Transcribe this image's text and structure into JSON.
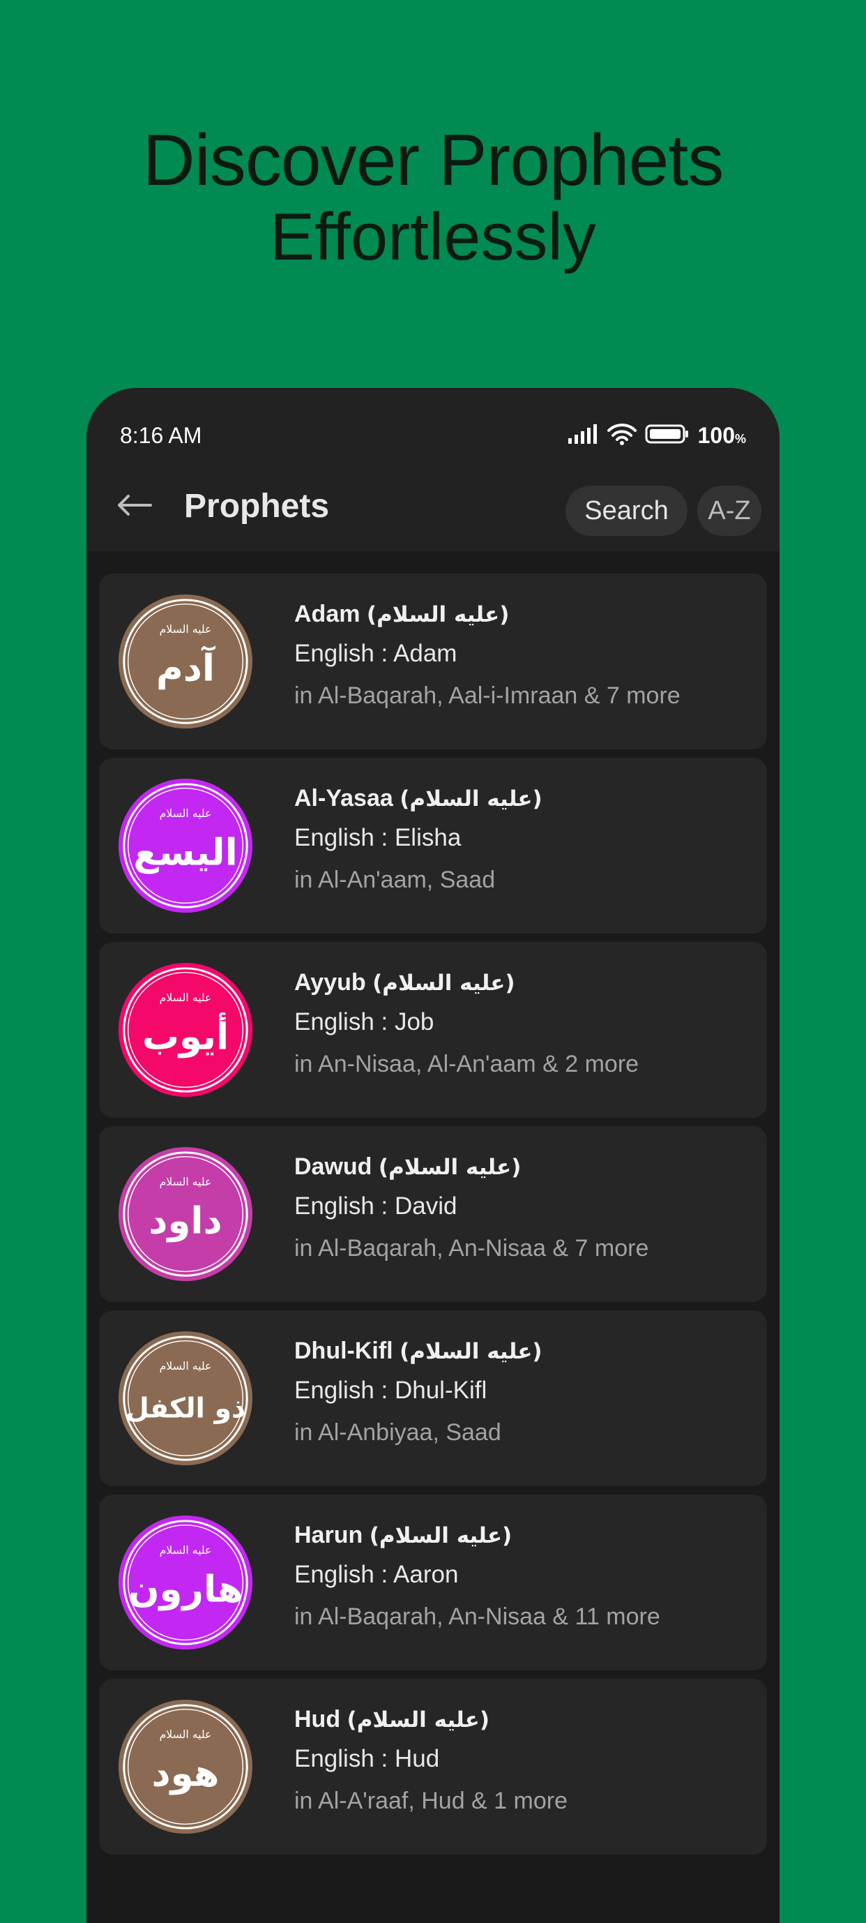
{
  "promo": {
    "headline_line1": "Discover Prophets",
    "headline_line2": "Effortlessly"
  },
  "status_bar": {
    "time": "8:16 AM",
    "battery": "100",
    "battery_unit": "%"
  },
  "toolbar": {
    "title": "Prophets",
    "search_label": "Search",
    "sort_label": "A-Z"
  },
  "prophets": [
    {
      "name": "Adam",
      "honorific": "(عليه السلام)",
      "english": "English : Adam",
      "surahs": "in Al-Baqarah, Aal-i-Imraan & 7 more",
      "color": "#8a6a52",
      "calligraphy": "آدم",
      "icon": "adam-calligraphy-icon"
    },
    {
      "name": "Al-Yasaa",
      "honorific": "(عليه السلام)",
      "english": "English : Elisha",
      "surahs": "in Al-An'aam, Saad",
      "color": "#c228f2",
      "calligraphy": "اليسع",
      "icon": "alyasaa-calligraphy-icon"
    },
    {
      "name": "Ayyub",
      "honorific": "(عليه السلام)",
      "english": "English : Job",
      "surahs": "in An-Nisaa, Al-An'aam & 2 more",
      "color": "#f4086a",
      "calligraphy": "أيوب",
      "icon": "ayyub-calligraphy-icon"
    },
    {
      "name": "Dawud",
      "honorific": "(عليه السلام)",
      "english": "English : David",
      "surahs": "in Al-Baqarah, An-Nisaa & 7 more",
      "color": "#c53da8",
      "calligraphy": "داود",
      "icon": "dawud-calligraphy-icon"
    },
    {
      "name": "Dhul-Kifl",
      "honorific": "(عليه السلام)",
      "english": "English : Dhul-Kifl",
      "surahs": "in Al-Anbiyaa, Saad",
      "color": "#8a6a52",
      "calligraphy": "ذو الكفل",
      "icon": "dhulkifl-calligraphy-icon"
    },
    {
      "name": "Harun",
      "honorific": "(عليه السلام)",
      "english": "English : Aaron",
      "surahs": "in Al-Baqarah, An-Nisaa & 11 more",
      "color": "#c228f2",
      "calligraphy": "هارون",
      "icon": "harun-calligraphy-icon"
    },
    {
      "name": "Hud",
      "honorific": "(عليه السلام)",
      "english": "English : Hud",
      "surahs": "in Al-A'raaf, Hud & 1 more",
      "color": "#8a6a52",
      "calligraphy": "هود",
      "icon": "hud-calligraphy-icon"
    }
  ]
}
